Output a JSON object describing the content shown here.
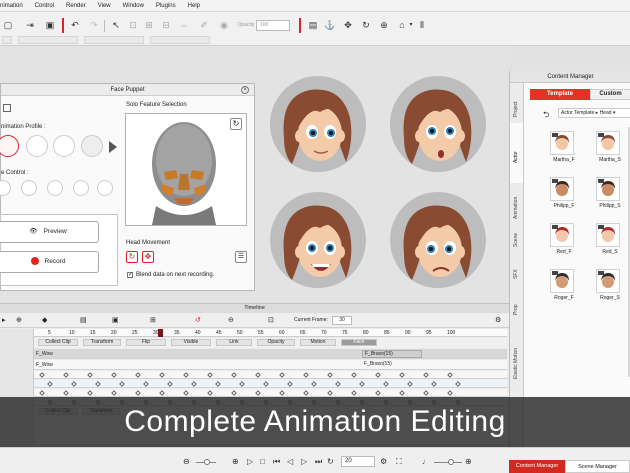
{
  "menu": [
    "nimation",
    "Create",
    "Control",
    "Render",
    "View",
    "Window",
    "Plugins",
    "Help"
  ],
  "toolbar": {
    "opacity_label": "Opacity",
    "opacity_value": "100"
  },
  "face_puppet": {
    "title": "Face Puppet",
    "animation_profile_label": "nimation Profile :",
    "face_control_label": "e Control :",
    "solo_feature_label": "Solo Feature Selection",
    "preview_label": "Preview",
    "record_label": "Record",
    "head_movement_label": "Head Movement",
    "blend_label": "Blend data on next recording."
  },
  "content_manager": {
    "title": "Content Manager",
    "tabs": [
      "Template",
      "Custom"
    ],
    "vertical_tabs": [
      "Project",
      "Actor",
      "Animation",
      "Scene",
      "SFX",
      "Prop",
      "Elastic Motion"
    ],
    "path": [
      "Actor Template",
      "Head"
    ],
    "characters": [
      {
        "name": "Martha_F",
        "hair": "#8a4b33",
        "skin": "#f3c7a5"
      },
      {
        "name": "Martha_S",
        "hair": "#8a4b33",
        "skin": "#f3c7a5"
      },
      {
        "name": "Philipp_F",
        "hair": "#3b2a20",
        "skin": "#c98b61"
      },
      {
        "name": "Philipp_S",
        "hair": "#3b2a20",
        "skin": "#c98b61"
      },
      {
        "name": "Red_F",
        "hair": "#b42a22",
        "skin": "#f1c8ab"
      },
      {
        "name": "Red_S",
        "hair": "#b42a22",
        "skin": "#f1c8ab"
      },
      {
        "name": "Roger_F",
        "hair": "#2c2c2c",
        "skin": "#d39b73"
      },
      {
        "name": "Roger_S",
        "hair": "#2c2c2c",
        "skin": "#d39b73"
      }
    ],
    "bottom_tabs": [
      "Content Manager",
      "Scene Manager"
    ]
  },
  "timeline": {
    "title": "Timeline",
    "current_frame_label": "Current Frame:",
    "current_frame_value": "30",
    "ruler": [
      "5",
      "10",
      "15",
      "20",
      "25",
      "30",
      "35",
      "40",
      "45",
      "50",
      "55",
      "60",
      "65",
      "70",
      "75",
      "80",
      "85",
      "90",
      "95",
      "100"
    ],
    "header_cells": [
      "Collect Clip",
      "Transform",
      "Flip",
      "Visible",
      "Link",
      "Opacity",
      "Motion",
      "Face"
    ],
    "tracks": [
      "F_Wow",
      "F_Wow"
    ],
    "clip_right": "F_Bravo(15)"
  },
  "banner": {
    "text": "Complete Animation Editing"
  },
  "playback": {
    "frame_value": "20"
  },
  "colors": {
    "accent": "#d7232b",
    "banner_bg": "#2b2b2b"
  }
}
